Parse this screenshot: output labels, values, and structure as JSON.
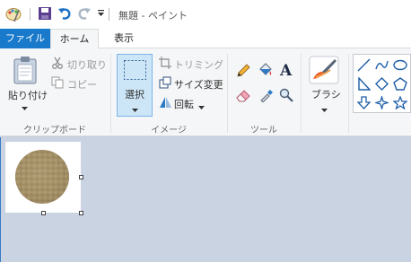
{
  "window": {
    "title": "無題 - ペイント"
  },
  "tabs": {
    "file": "ファイル",
    "home": "ホーム",
    "view": "表示"
  },
  "clipboard": {
    "paste": "貼り付け",
    "cut": "切り取り",
    "copy": "コピー",
    "group": "クリップボード"
  },
  "image": {
    "select": "選択",
    "crop": "トリミング",
    "resize": "サイズ変更",
    "rotate": "回転",
    "group": "イメージ"
  },
  "tools": {
    "group": "ツール"
  },
  "brushes": {
    "label": "ブラシ"
  },
  "colors": {
    "accent": "#1979ca",
    "selection": "#cde6f7"
  }
}
